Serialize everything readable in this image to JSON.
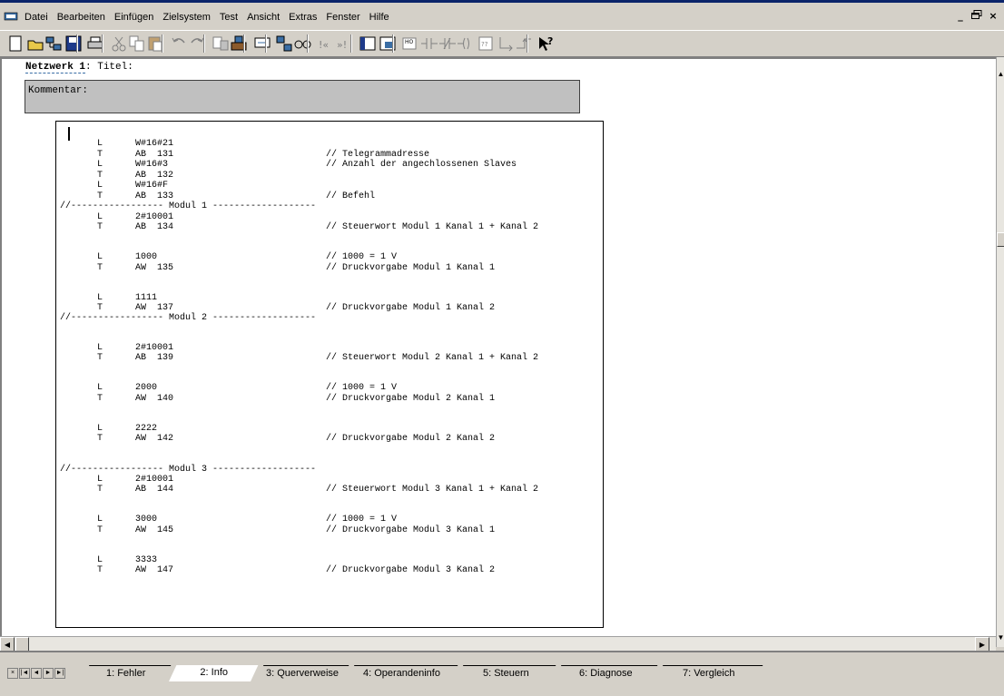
{
  "menubar": {
    "items": [
      "Datei",
      "Bearbeiten",
      "Einfügen",
      "Zielsystem",
      "Test",
      "Ansicht",
      "Extras",
      "Fenster",
      "Hilfe"
    ],
    "window_controls": [
      "_",
      "×"
    ]
  },
  "toolbar": {
    "icons": [
      "new-icon",
      "open-icon",
      "accessible-nodes-icon",
      "save-icon",
      "print-icon",
      "cut-icon",
      "copy-icon",
      "paste-icon",
      "undo-icon",
      "redo-icon",
      "download-icon",
      "upload-icon",
      "monitor-icon",
      "network-icon",
      "glasses-icon",
      "first-icon",
      "last-icon",
      "overview-icon",
      "zoom-icon",
      "ladder-icon",
      "contact-no-icon",
      "contact-nc-icon",
      "coil-icon",
      "box-icon",
      "branch-open-icon",
      "branch-close-icon",
      "help-icon"
    ]
  },
  "editor": {
    "network_label": "Netzwerk 1",
    "network_title_suffix": ": Titel:",
    "comment_label": "Kommentar:",
    "code": [
      {
        "op": "L",
        "arg": "W#16#21",
        "comment": ""
      },
      {
        "op": "T",
        "arg": "AB  131",
        "comment": "// Telegrammadresse"
      },
      {
        "op": "L",
        "arg": "W#16#3",
        "comment": "// Anzahl der angechlossenen Slaves"
      },
      {
        "op": "T",
        "arg": "AB  132",
        "comment": ""
      },
      {
        "op": "L",
        "arg": "W#16#F",
        "comment": ""
      },
      {
        "op": "T",
        "arg": "AB  133",
        "comment": "// Befehl"
      },
      {
        "sep": "//----------------- Modul 1 -------------------"
      },
      {
        "op": "L",
        "arg": "2#10001",
        "comment": ""
      },
      {
        "op": "T",
        "arg": "AB  134",
        "comment": "// Steuerwort Modul 1 Kanal 1 + Kanal 2"
      },
      {
        "blank": true
      },
      {
        "op": "L",
        "arg": "1000",
        "comment": "// 1000 = 1 V"
      },
      {
        "op": "T",
        "arg": "AW  135",
        "comment": "// Druckvorgabe Modul 1 Kanal 1"
      },
      {
        "blank": true
      },
      {
        "op": "L",
        "arg": "1111",
        "comment": ""
      },
      {
        "op": "T",
        "arg": "AW  137",
        "comment": "// Druckvorgabe Modul 1 Kanal 2"
      },
      {
        "sep": "//----------------- Modul 2 -------------------"
      },
      {
        "blank": true
      },
      {
        "op": "L",
        "arg": "2#10001",
        "comment": ""
      },
      {
        "op": "T",
        "arg": "AB  139",
        "comment": "// Steuerwort Modul 2 Kanal 1 + Kanal 2"
      },
      {
        "blank": true
      },
      {
        "op": "L",
        "arg": "2000",
        "comment": "// 1000 = 1 V"
      },
      {
        "op": "T",
        "arg": "AW  140",
        "comment": "// Druckvorgabe Modul 2 Kanal 1"
      },
      {
        "blank": true
      },
      {
        "op": "L",
        "arg": "2222",
        "comment": ""
      },
      {
        "op": "T",
        "arg": "AW  142",
        "comment": "// Druckvorgabe Modul 2 Kanal 2"
      },
      {
        "blank": true
      },
      {
        "sep": "//----------------- Modul 3 -------------------"
      },
      {
        "op": "L",
        "arg": "2#10001",
        "comment": ""
      },
      {
        "op": "T",
        "arg": "AB  144",
        "comment": "// Steuerwort Modul 3 Kanal 1 + Kanal 2"
      },
      {
        "blank": true
      },
      {
        "op": "L",
        "arg": "3000",
        "comment": "// 1000 = 1 V"
      },
      {
        "op": "T",
        "arg": "AW  145",
        "comment": "// Druckvorgabe Modul 3 Kanal 1"
      },
      {
        "blank": true
      },
      {
        "op": "L",
        "arg": "3333",
        "comment": ""
      },
      {
        "op": "T",
        "arg": "AW  147",
        "comment": "// Druckvorgabe Modul 3 Kanal 2"
      }
    ]
  },
  "tabs": [
    {
      "label": "1: Fehler",
      "active": false
    },
    {
      "label": "2: Info",
      "active": true
    },
    {
      "label": "3: Querverweise",
      "active": false
    },
    {
      "label": "4: Operandeninfo",
      "active": false
    },
    {
      "label": "5: Steuern",
      "active": false
    },
    {
      "label": "6: Diagnose",
      "active": false
    },
    {
      "label": "7: Vergleich",
      "active": false
    }
  ],
  "nav_buttons": [
    "×",
    "|◄",
    "◄",
    "►",
    "►|"
  ]
}
